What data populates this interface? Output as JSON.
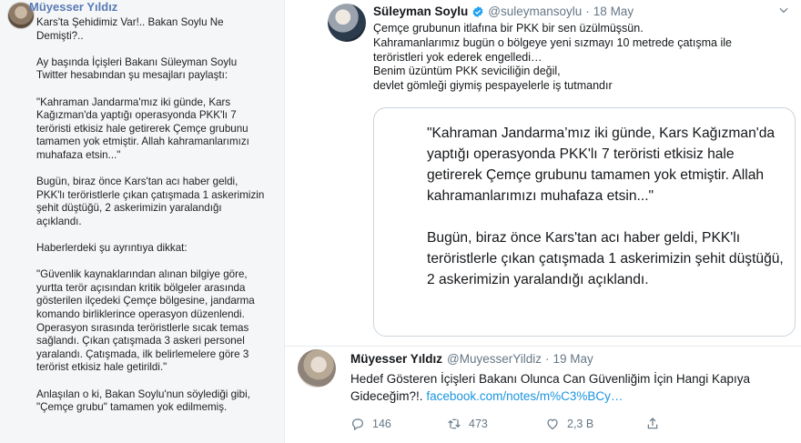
{
  "left_note": {
    "author": "Müyesser Yıldız",
    "paragraphs": [
      "Kars'ta Şehidimiz Var!.. Bakan Soylu Ne\nDemişti?..",
      "Ay başında İçişleri Bakanı Süleyman Soylu\nTwitter hesabından şu mesajları paylaştı:",
      "\"Kahraman Jandarma'mız iki günde, Kars\nKağızman'da yaptığı operasyonda PKK'lı 7\nteröristi etkisiz hale getirerek Çemçe grubunu\ntamamen yok etmiştir. Allah kahramanlarımızı\nmuhafaza etsin...\"",
      "Bugün, biraz önce Kars'tan acı haber geldi,\nPKK'lı teröristlerle çıkan çatışmada 1 askerimizin\nşehit düştüğü, 2 askerimizin yaralandığı\naçıklandı.",
      "Haberlerdeki şu ayrıntıya dikkat:",
      "\"Güvenlik kaynaklarından alınan bilgiye göre,\nyurtta terör açısından kritik bölgeler arasında\ngösterilen ilçedeki Çemçe bölgesine, jandarma\nkomando birliklerince operasyon düzenlendi.\nOperasyon sırasında teröristlerle sıcak temas\nsağlandı. Çıkan çatışmada 3 askeri personel\nyaralandı. Çatışmada, ilk belirlemelere göre 3\nterörist etkisiz hale getirildi.\"",
      "Anlaşılan o ki, Bakan Soylu'nun söylediği gibi,\n\"Çemçe grubu\" tamamen yok edilmemiş."
    ]
  },
  "tweet1": {
    "name": "Süleyman Soylu",
    "handle": "@suleymansoylu",
    "dot": "·",
    "date": "18 May",
    "text": "Çemçe grubunun itlafına bir PKK bir sen üzülmüşsün.\nKahramanlarımız bugün o bölgeye yeni sızmayı 10 metrede çatışma ile\nteröristleri yok ederek engelledi…\nBenim üzüntüm PKK seviciliğin değil,\ndevlet gömleği giymiş pespayelerle iş tutmandır",
    "quote": [
      "\"Kahraman Jandarma’mız iki günde, Kars Kağızman'da yaptığı operasyonda PKK'lı 7 teröristi etkisiz hale getirerek Çemçe grubunu tamamen yok etmiştir. Allah kahramanlarımızı muhafaza etsin...\"",
      "Bugün, biraz önce Kars'tan acı haber geldi, PKK'lı teröristlerle çıkan çatışmada 1 askerimizin şehit düştüğü, 2 askerimizin yaralandığı açıklandı."
    ]
  },
  "tweet2": {
    "name": "Müyesser Yıldız",
    "handle": "@MuyesserYildiz",
    "dot": "·",
    "date": "19 May",
    "text": "Hedef Gösteren İçişleri Bakanı Olunca Can Güvenliğim İçin Hangi Kapıya Gideceğim?!.",
    "link": "facebook.com/notes/m%C3%BCy…",
    "replies": "146",
    "retweets": "473",
    "likes": "2,3 B"
  },
  "colors": {
    "link": "#1b95e0",
    "secondary": "#657786",
    "left_author": "#5a7bb5",
    "verified": "#1da1f2"
  },
  "icons": [
    "verified-badge-icon",
    "chevron-down-icon",
    "reply-icon",
    "retweet-icon",
    "like-icon",
    "share-icon"
  ]
}
